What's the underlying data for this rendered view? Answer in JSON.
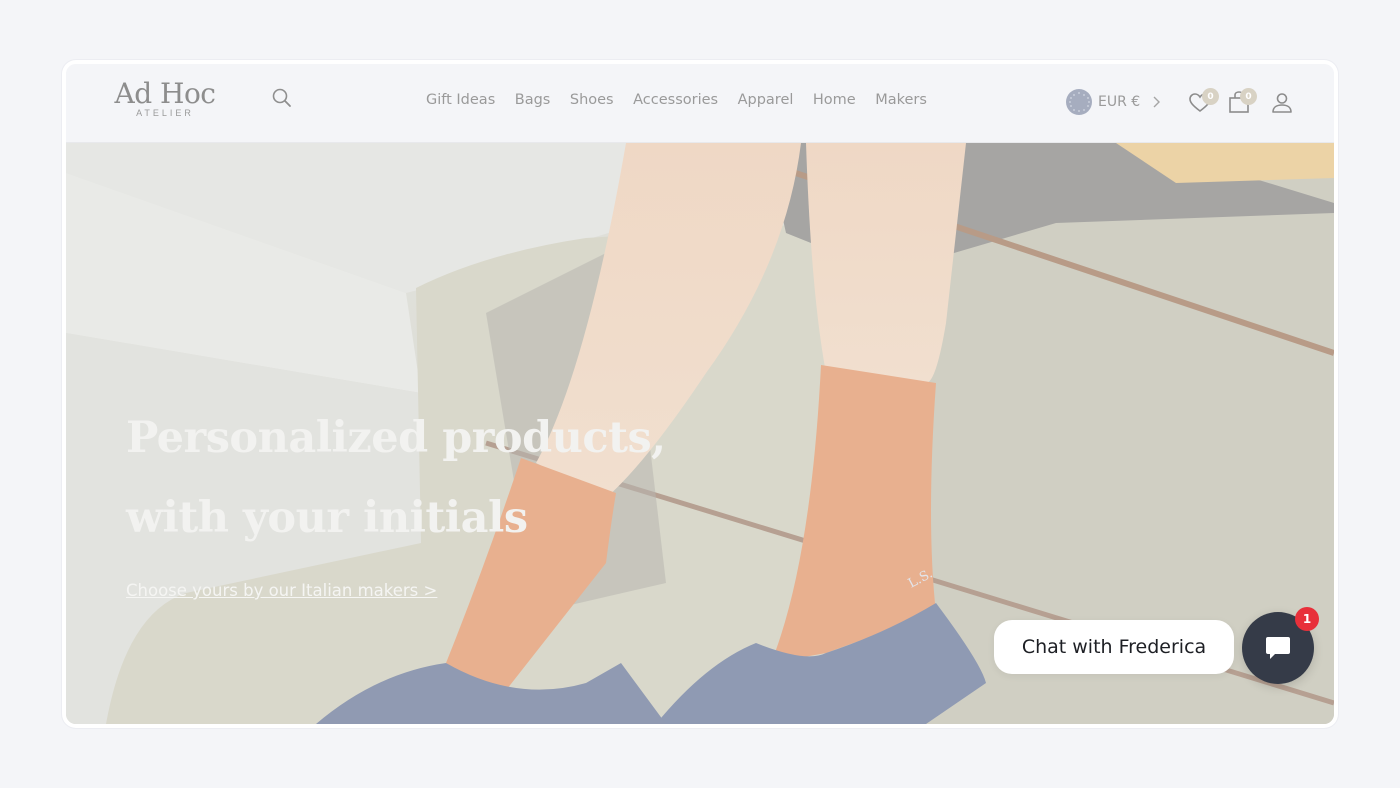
{
  "brand": {
    "name": "Ad Hoc",
    "tagline": "ATELIER"
  },
  "nav": {
    "items": [
      {
        "label": "Gift Ideas"
      },
      {
        "label": "Bags"
      },
      {
        "label": "Shoes"
      },
      {
        "label": "Accessories"
      },
      {
        "label": "Apparel"
      },
      {
        "label": "Home"
      },
      {
        "label": "Makers"
      }
    ]
  },
  "header": {
    "search_icon": "search-icon",
    "currency": {
      "label": "EUR €",
      "flag": "eu-flag-icon"
    },
    "wishlist_count": "0",
    "cart_count": "0",
    "account_icon": "user-icon"
  },
  "hero": {
    "title_line1": "Personalized products,",
    "title_line2": "with your initials",
    "cta": "Choose yours by our Italian makers >",
    "image_caption_initials": "L.S."
  },
  "chat": {
    "label": "Chat with Frederica",
    "unread": "1"
  },
  "colors": {
    "page_bg": "#f4f5f8",
    "nav_text": "#9a9a9a",
    "badge_bg": "#d8d2c4",
    "chat_fab": "#353b48",
    "chat_badge": "#e8303a",
    "sock": "#e9b08f",
    "slipper": "#8f9ab3"
  }
}
